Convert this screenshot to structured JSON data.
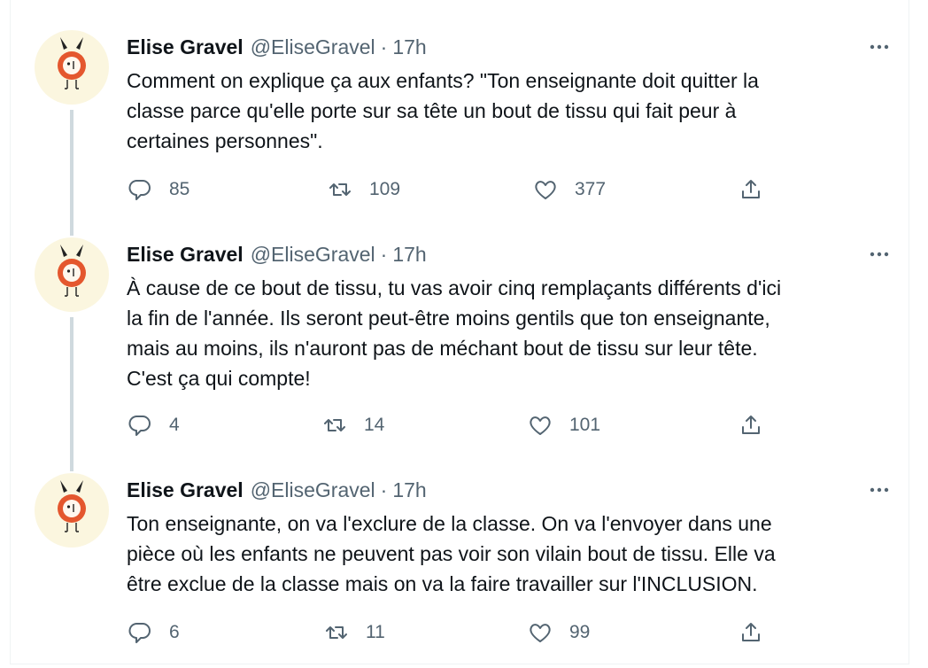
{
  "tweets": [
    {
      "author": "Elise Gravel",
      "handle": "@EliseGravel",
      "separator": "·",
      "time": "17h",
      "text": "Comment on explique ça aux enfants? \"Ton enseignante doit quitter la\nclasse parce qu'elle porte sur sa tête un bout de tissu qui fait peur à\ncertaines personnes\".",
      "replies": "85",
      "retweets": "109",
      "likes": "377"
    },
    {
      "author": "Elise Gravel",
      "handle": "@EliseGravel",
      "separator": "·",
      "time": "17h",
      "text": "À cause de ce bout de tissu, tu vas avoir cinq remplaçants différents d'ici\nla fin de l'année. Ils seront peut-être moins gentils que ton enseignante,\nmais au moins, ils n'auront pas de méchant bout de tissu sur leur tête.\nC'est ça qui compte!",
      "replies": "4",
      "retweets": "14",
      "likes": "101"
    },
    {
      "author": "Elise Gravel",
      "handle": "@EliseGravel",
      "separator": "·",
      "time": "17h",
      "text": "Ton enseignante, on va l'exclure de la classe. On va l'envoyer dans une\npièce où les enfants ne peuvent pas voir son vilain bout de tissu. Elle va\nêtre exclue de la classe mais on va la faire travailler sur l'INCLUSION.",
      "replies": "6",
      "retweets": "11",
      "likes": "99"
    }
  ],
  "colors": {
    "text_primary": "#0f1419",
    "text_secondary": "#536471",
    "thread_line": "#cfd9de",
    "avatar_bg": "#fbf6df",
    "avatar_orange": "#e4572e"
  },
  "icons": [
    "avatar-character",
    "more-icon",
    "reply-icon",
    "retweet-icon",
    "like-icon",
    "share-icon"
  ]
}
